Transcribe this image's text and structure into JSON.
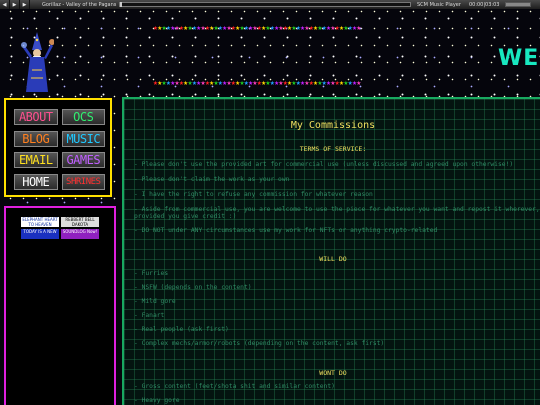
{
  "player": {
    "track_title": "Gorillaz - Valley of the Pagans",
    "player_name": "SCM Music Player",
    "time": "00:00|03:03"
  },
  "banner": {
    "title_fragment": "WEl",
    "star_colors": [
      "#ff2020",
      "#ffd800",
      "#20d020",
      "#20a0ff",
      "#c020ff",
      "#ff40c0"
    ]
  },
  "nav": {
    "items": [
      {
        "label": "ABOUT",
        "color": "#ff5090"
      },
      {
        "label": "OCS",
        "color": "#30f070"
      },
      {
        "label": "BLOG",
        "color": "#ff8020"
      },
      {
        "label": "MUSIC",
        "color": "#20c8ff"
      },
      {
        "label": "EMAIL",
        "color": "#ffe020"
      },
      {
        "label": "GAMES",
        "color": "#c060ff"
      },
      {
        "label": "HOME",
        "color": "#ffffff"
      },
      {
        "label": "SHRINES",
        "color": "#ff3030"
      }
    ]
  },
  "buttons88": [
    {
      "text": "ELEPHANT HEART TO HEAVEN",
      "bg": "#ffffff",
      "fg": "#1030a0"
    },
    {
      "text": "REBBERT BELL DAKOTA",
      "bg": "#dddddd",
      "fg": "#000000"
    },
    {
      "text": "TODAY IS A NEW",
      "bg": "#1a30c0",
      "fg": "#ffffff"
    },
    {
      "text": "SOUNDLOG Now!",
      "bg": "#9020c0",
      "fg": "#ffffff"
    }
  ],
  "content": {
    "title": "My Commissions",
    "tos_heading": "TERMS OF SERVICE:",
    "tos_items": [
      "- Please don't use the provided art for commercial use (unless discussed and agreed upon otherwise!)",
      "- Please don't claim the work as your own",
      "- I have the right to refuse any commission for whatever reason",
      "- Aside from commercial use, you are welcome to use the piece for whatever you want and repost it wherever,",
      "  provided you give credit :)",
      "- DO NOT under ANY circumstances use my work for NFTs or anything crypto-related"
    ],
    "will_do_heading": "WILL DO",
    "will_do_items": [
      "- Furries",
      "- NSFW (depends on the content)",
      "- Mild gore",
      "- Fanart",
      "- Real people (ask first)",
      "- Complex mechs/armor/robots (depending on the content, ask first)"
    ],
    "wont_do_heading": "WONT DO",
    "wont_do_items": [
      "- Gross content (feet/shota shit and similar content)",
      "- Heavy gore"
    ]
  }
}
